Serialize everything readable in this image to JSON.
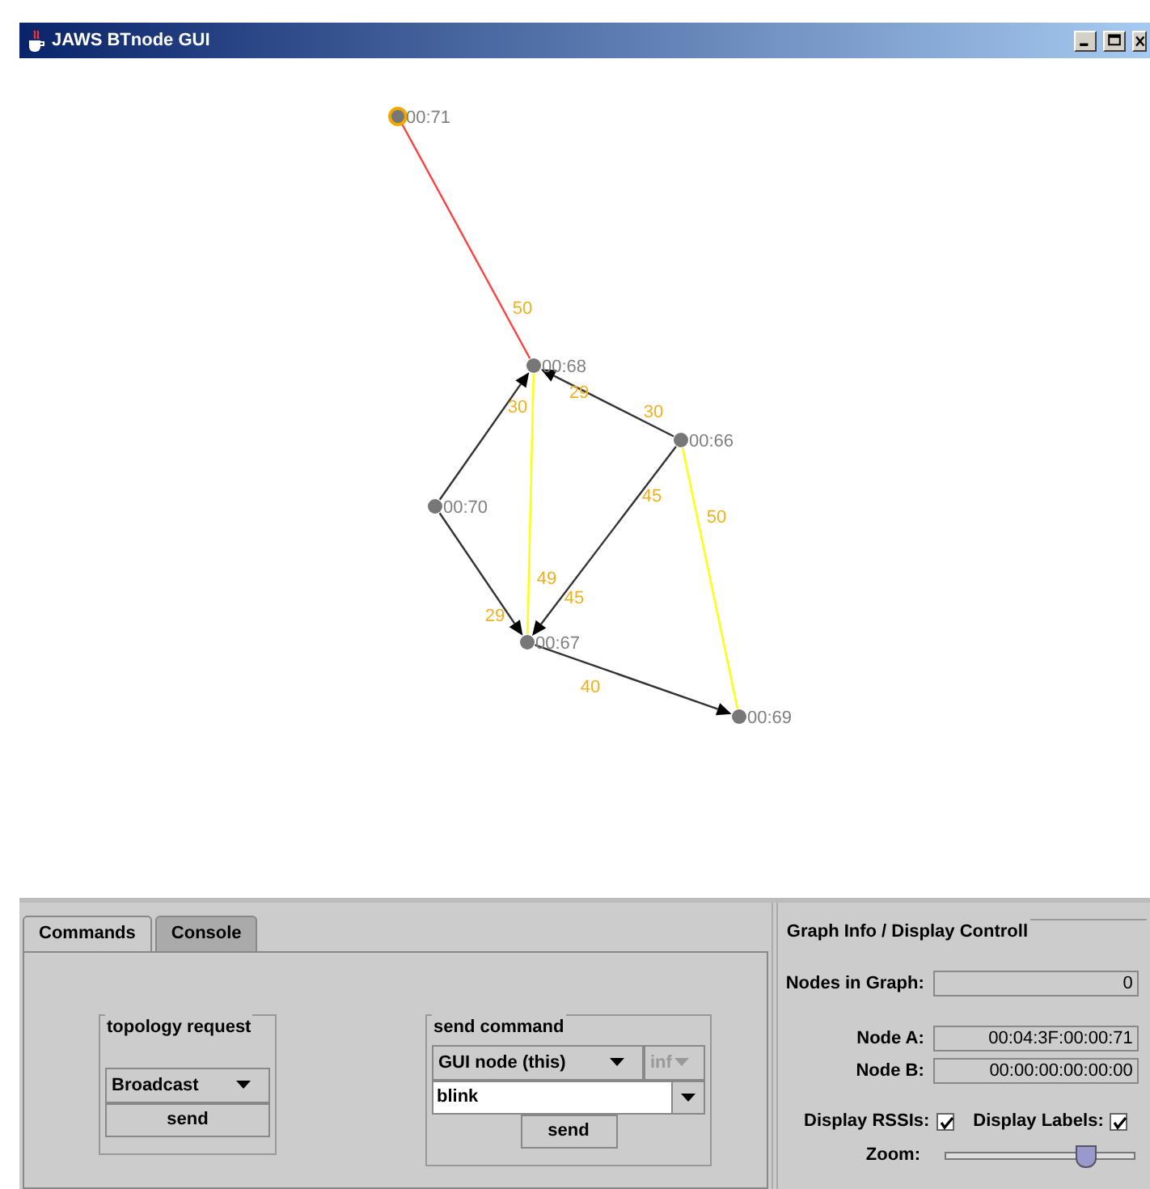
{
  "window": {
    "title": "JAWS BTnode GUI"
  },
  "graph": {
    "nodes": [
      {
        "label": "00:71",
        "selected": true
      },
      {
        "label": "00:68",
        "selected": false
      },
      {
        "label": "00:66",
        "selected": false
      },
      {
        "label": "00:70",
        "selected": false
      },
      {
        "label": "00:67",
        "selected": false
      },
      {
        "label": "00:69",
        "selected": false
      }
    ],
    "edges": [
      {
        "color": "#ff4040",
        "directed": false,
        "labels": [
          "50"
        ]
      },
      {
        "color": "#333333",
        "directed": true,
        "labels": [
          "30"
        ]
      },
      {
        "color": "#333333",
        "directed": true,
        "labels": [
          "30",
          "29"
        ]
      },
      {
        "color": "#ffff00",
        "directed": false,
        "labels": [
          "49"
        ]
      },
      {
        "color": "#333333",
        "directed": true,
        "labels": [
          "29"
        ]
      },
      {
        "color": "#333333",
        "directed": true,
        "labels": [
          "45",
          "45"
        ]
      },
      {
        "color": "#333333",
        "directed": true,
        "labels": [
          "40"
        ]
      },
      {
        "color": "#ffff00",
        "directed": false,
        "labels": [
          "50"
        ]
      }
    ]
  },
  "tabs": [
    {
      "label": "Commands",
      "selected": true
    },
    {
      "label": "Console",
      "selected": false
    }
  ],
  "topology_request": {
    "title": "topology request",
    "target": "Broadcast",
    "button": "send"
  },
  "send_command": {
    "title": "send command",
    "target": "GUI node (this)",
    "count": {
      "value": "inf",
      "disabled": true
    },
    "command": "blink",
    "button": "send"
  },
  "graph_info": {
    "title": "Graph Info / Display Controll",
    "fields": [
      {
        "label": "Nodes in Graph:",
        "value": "0"
      },
      {
        "label": "Node A:",
        "value": "00:04:3F:00:00:71"
      },
      {
        "label": "Node B:",
        "value": "00:00:00:00:00:00"
      }
    ],
    "display_rssis": {
      "label": "Display RSSIs:",
      "checked": true
    },
    "display_labels": {
      "label": "Display Labels:",
      "checked": true
    },
    "zoom": {
      "label": "Zoom:",
      "level": 0.74
    }
  }
}
